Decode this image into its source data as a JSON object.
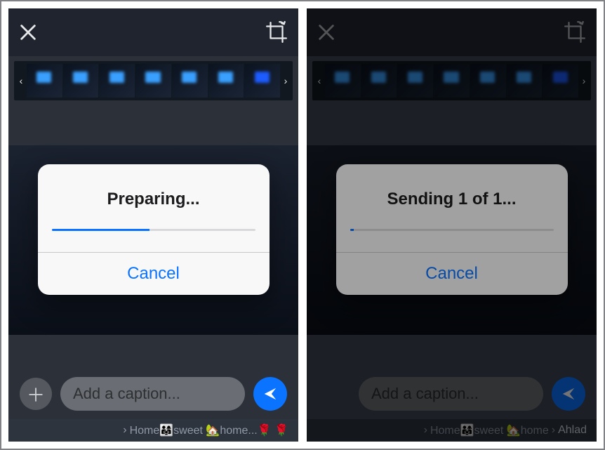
{
  "left": {
    "modal": {
      "title": "Preparing...",
      "cancel": "Cancel",
      "progress_pct": 48
    },
    "caption_placeholder": "Add a caption...",
    "recipient_text": "Home👨‍👩‍👧sweet 🏡home...🌹 🌹"
  },
  "right": {
    "modal": {
      "title": "Sending 1 of 1...",
      "cancel": "Cancel",
      "progress_pct": 2
    },
    "caption_placeholder": "Add a caption...",
    "recipient_primary": "Home👨‍👩‍👧sweet 🏡home",
    "recipient_secondary": "Ahlad"
  }
}
